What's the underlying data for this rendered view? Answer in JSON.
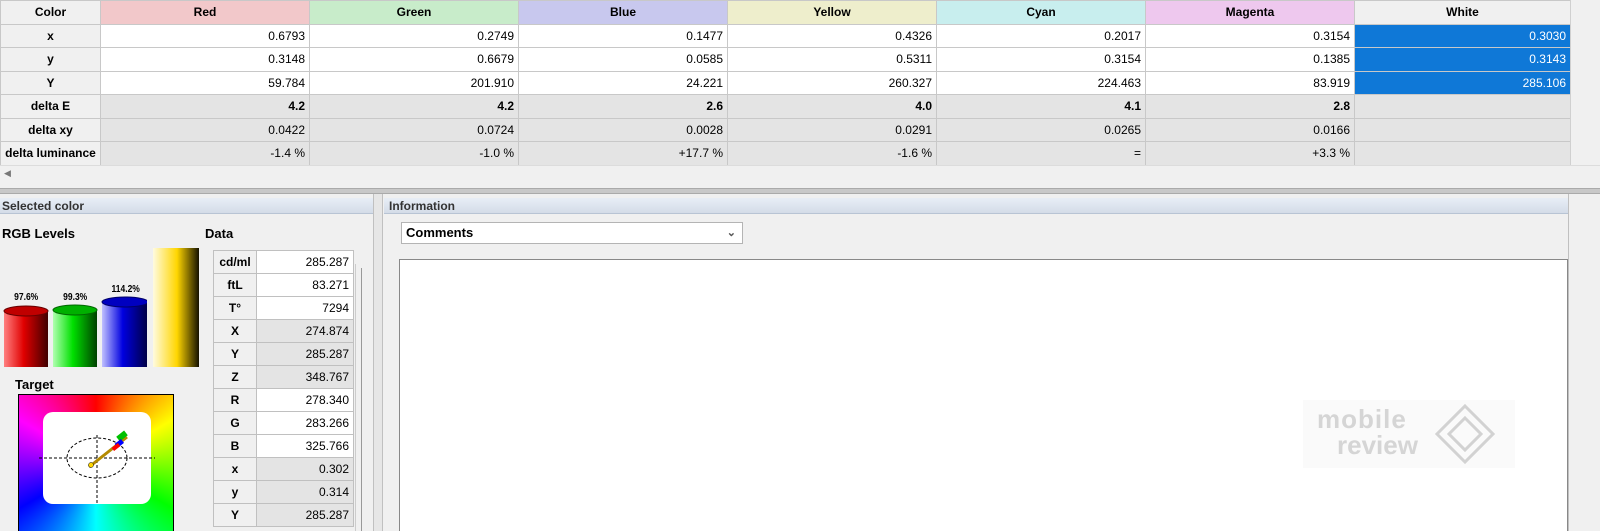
{
  "color_table": {
    "corner_label": "Color",
    "columns": [
      {
        "label": "Red",
        "color": "#f2c8ca"
      },
      {
        "label": "Green",
        "color": "#c8ecca"
      },
      {
        "label": "Blue",
        "color": "#c8c8ee"
      },
      {
        "label": "Yellow",
        "color": "#eeeecc"
      },
      {
        "label": "Cyan",
        "color": "#c8eeee"
      },
      {
        "label": "Magenta",
        "color": "#eec8ee"
      },
      {
        "label": "White",
        "color": "#f0f0f0"
      }
    ],
    "rows": [
      {
        "label": "x",
        "values": [
          "0.6793",
          "0.2749",
          "0.1477",
          "0.4326",
          "0.2017",
          "0.3154",
          "0.3030"
        ]
      },
      {
        "label": "y",
        "values": [
          "0.3148",
          "0.6679",
          "0.0585",
          "0.5311",
          "0.3154",
          "0.1385",
          "0.3143"
        ]
      },
      {
        "label": "Y",
        "values": [
          "59.784",
          "201.910",
          "24.221",
          "260.327",
          "224.463",
          "83.919",
          "285.106"
        ]
      },
      {
        "label": "delta E",
        "values": [
          "4.2",
          "4.2",
          "2.6",
          "4.0",
          "4.1",
          "2.8",
          ""
        ]
      },
      {
        "label": "delta xy",
        "values": [
          "0.0422",
          "0.0724",
          "0.0028",
          "0.0291",
          "0.0265",
          "0.0166",
          ""
        ]
      },
      {
        "label": "delta luminance",
        "values": [
          "-1.4 %",
          "-1.0 %",
          "+17.7 %",
          "-1.6 %",
          "=",
          "+3.3 %",
          ""
        ]
      }
    ],
    "selection_color": "#0f78d7"
  },
  "selected_panel": {
    "header": "Selected color",
    "rgb_title": "RGB Levels",
    "rgb_levels": [
      {
        "label": "97.6%",
        "value": 97.6,
        "color": "red"
      },
      {
        "label": "99.3%",
        "value": 99.3,
        "color": "green"
      },
      {
        "label": "114.2%",
        "value": 114.2,
        "color": "blue"
      }
    ],
    "target_title": "Target",
    "data_title": "Data",
    "data_rows": [
      {
        "label": "cd/ml",
        "value": "285.287"
      },
      {
        "label": "ftL",
        "value": "83.271"
      },
      {
        "label": "T°",
        "value": "7294"
      },
      {
        "label": "X",
        "value": "274.874"
      },
      {
        "label": "Y",
        "value": "285.287"
      },
      {
        "label": "Z",
        "value": "348.767"
      },
      {
        "label": "R",
        "value": "278.340"
      },
      {
        "label": "G",
        "value": "283.266"
      },
      {
        "label": "B",
        "value": "325.766"
      },
      {
        "label": "x",
        "value": "0.302"
      },
      {
        "label": "y",
        "value": "0.314"
      },
      {
        "label": "Y",
        "value": "285.287"
      }
    ]
  },
  "info_panel": {
    "header": "Information",
    "dropdown_value": "Comments"
  },
  "watermark": {
    "line1": "mobile",
    "line2": "review"
  }
}
